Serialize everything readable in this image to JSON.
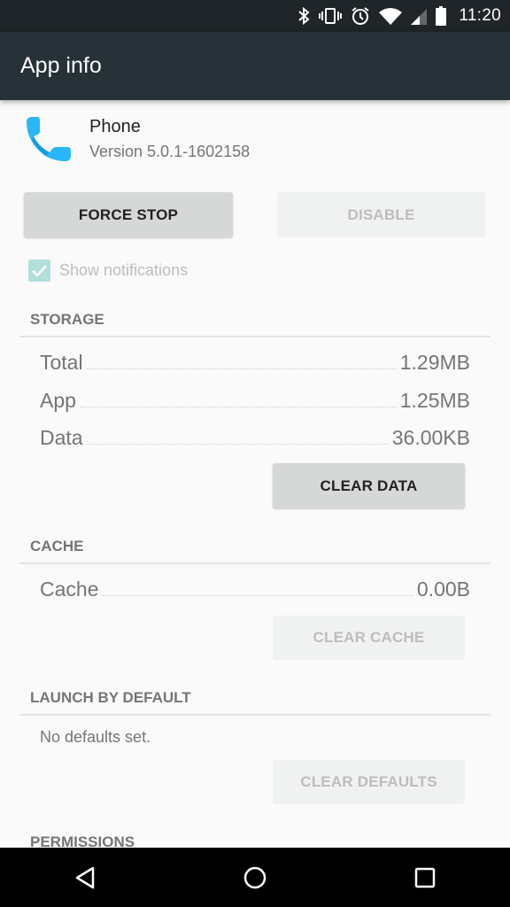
{
  "status_bar": {
    "time": "11:20",
    "icons": [
      "bluetooth-icon",
      "vibrate-icon",
      "alarm-icon",
      "wifi-icon",
      "cell-signal-icon",
      "battery-icon"
    ]
  },
  "app_bar": {
    "title": "App info"
  },
  "app": {
    "name": "Phone",
    "version": "Version 5.0.1-1602158",
    "icon": "phone-icon",
    "icon_color": "#1ea8f2"
  },
  "actions": {
    "force_stop_label": "FORCE STOP",
    "disable_label": "DISABLE"
  },
  "notifications": {
    "label": "Show notifications",
    "checked": true
  },
  "storage": {
    "header": "STORAGE",
    "rows": [
      {
        "label": "Total",
        "value": "1.29MB"
      },
      {
        "label": "App",
        "value": "1.25MB"
      },
      {
        "label": "Data",
        "value": "36.00KB"
      }
    ],
    "clear_data_label": "CLEAR DATA"
  },
  "cache": {
    "header": "CACHE",
    "rows": [
      {
        "label": "Cache",
        "value": "0.00B"
      }
    ],
    "clear_cache_label": "CLEAR CACHE"
  },
  "launch_by_default": {
    "header": "LAUNCH BY DEFAULT",
    "text": "No defaults set.",
    "clear_defaults_label": "CLEAR DEFAULTS"
  },
  "permissions": {
    "header": "PERMISSIONS"
  },
  "nav_bar": {
    "buttons": [
      "back-icon",
      "home-icon",
      "recents-icon"
    ]
  }
}
